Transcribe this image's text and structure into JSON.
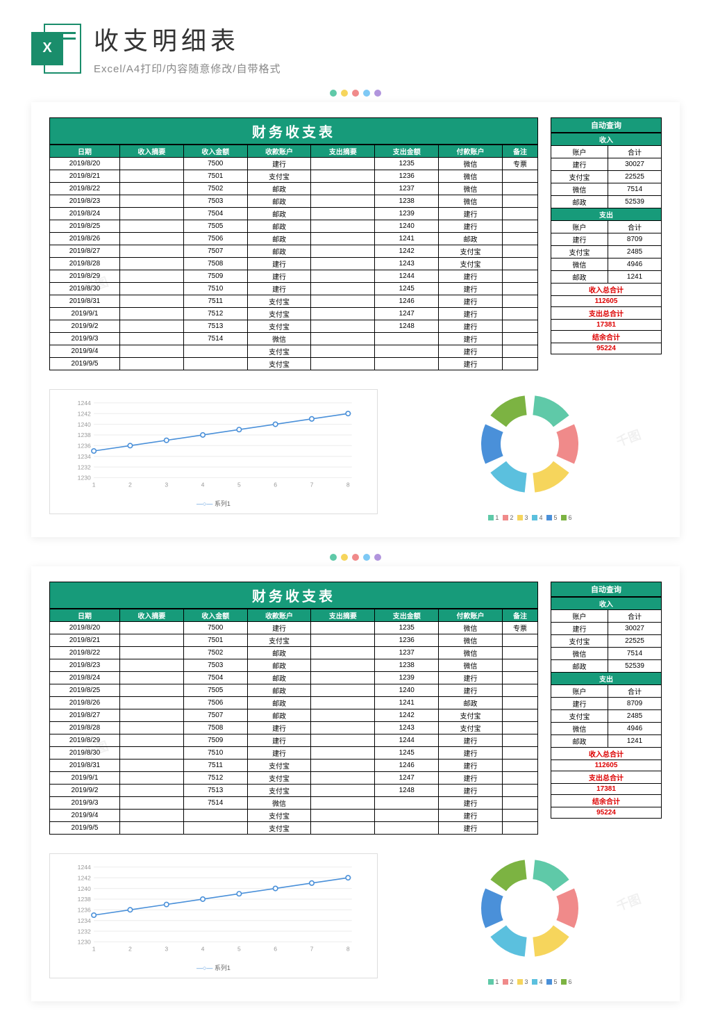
{
  "header": {
    "title": "收支明细表",
    "subtitle": "Excel/A4打印/内容随意修改/自带格式",
    "icon_label": "X"
  },
  "dots": [
    "#5fc9a8",
    "#f6d55c",
    "#f08a8a",
    "#7ec9f5",
    "#b195dd"
  ],
  "main_table": {
    "title": "财务收支表",
    "headers": [
      "日期",
      "收入摘要",
      "收入金额",
      "收款账户",
      "支出摘要",
      "支出金额",
      "付款账户",
      "备注"
    ],
    "rows": [
      [
        "2019/8/20",
        "",
        "7500",
        "建行",
        "",
        "1235",
        "微信",
        "专票"
      ],
      [
        "2019/8/21",
        "",
        "7501",
        "支付宝",
        "",
        "1236",
        "微信",
        ""
      ],
      [
        "2019/8/22",
        "",
        "7502",
        "邮政",
        "",
        "1237",
        "微信",
        ""
      ],
      [
        "2019/8/23",
        "",
        "7503",
        "邮政",
        "",
        "1238",
        "微信",
        ""
      ],
      [
        "2019/8/24",
        "",
        "7504",
        "邮政",
        "",
        "1239",
        "建行",
        ""
      ],
      [
        "2019/8/25",
        "",
        "7505",
        "邮政",
        "",
        "1240",
        "建行",
        ""
      ],
      [
        "2019/8/26",
        "",
        "7506",
        "邮政",
        "",
        "1241",
        "邮政",
        ""
      ],
      [
        "2019/8/27",
        "",
        "7507",
        "邮政",
        "",
        "1242",
        "支付宝",
        ""
      ],
      [
        "2019/8/28",
        "",
        "7508",
        "建行",
        "",
        "1243",
        "支付宝",
        ""
      ],
      [
        "2019/8/29",
        "",
        "7509",
        "建行",
        "",
        "1244",
        "建行",
        ""
      ],
      [
        "2019/8/30",
        "",
        "7510",
        "建行",
        "",
        "1245",
        "建行",
        ""
      ],
      [
        "2019/8/31",
        "",
        "7511",
        "支付宝",
        "",
        "1246",
        "建行",
        ""
      ],
      [
        "2019/9/1",
        "",
        "7512",
        "支付宝",
        "",
        "1247",
        "建行",
        ""
      ],
      [
        "2019/9/2",
        "",
        "7513",
        "支付宝",
        "",
        "1248",
        "建行",
        ""
      ],
      [
        "2019/9/3",
        "",
        "7514",
        "微信",
        "",
        "",
        "建行",
        ""
      ],
      [
        "2019/9/4",
        "",
        "",
        "支付宝",
        "",
        "",
        "建行",
        ""
      ],
      [
        "2019/9/5",
        "",
        "",
        "支付宝",
        "",
        "",
        "建行",
        ""
      ]
    ]
  },
  "side": {
    "auto_query": "自动查询",
    "income_label": "收入",
    "expense_label": "支出",
    "col_account": "账户",
    "col_total": "合计",
    "income_rows": [
      [
        "建行",
        "30027"
      ],
      [
        "支付宝",
        "22525"
      ],
      [
        "微信",
        "7514"
      ],
      [
        "邮政",
        "52539"
      ]
    ],
    "expense_rows": [
      [
        "建行",
        "8709"
      ],
      [
        "支付宝",
        "2485"
      ],
      [
        "微信",
        "4946"
      ],
      [
        "邮政",
        "1241"
      ]
    ],
    "total_income_label": "收入总合计",
    "total_income_value": "112605",
    "total_expense_label": "支出总合计",
    "total_expense_value": "17381",
    "balance_label": "结余合计",
    "balance_value": "95224"
  },
  "chart_data": [
    {
      "type": "line",
      "title": "",
      "ylabel": "",
      "xlabel": "",
      "x": [
        1,
        2,
        3,
        4,
        5,
        6,
        7,
        8
      ],
      "values": [
        1235,
        1236,
        1237,
        1238,
        1239,
        1240,
        1241,
        1242
      ],
      "ylim": [
        1230,
        1244
      ],
      "y_ticks": [
        1230,
        1232,
        1234,
        1236,
        1238,
        1240,
        1242,
        1244
      ],
      "series_name": "系列1",
      "color": "#4a90d9"
    },
    {
      "type": "donut",
      "categories": [
        "1",
        "2",
        "3",
        "4",
        "5",
        "6"
      ],
      "values": [
        1,
        1,
        1,
        1,
        1,
        1
      ],
      "colors": [
        "#5fc9a8",
        "#f08a8a",
        "#f6d55c",
        "#5bc0de",
        "#4a90d9",
        "#7cb342"
      ]
    }
  ],
  "watermark": "千图"
}
